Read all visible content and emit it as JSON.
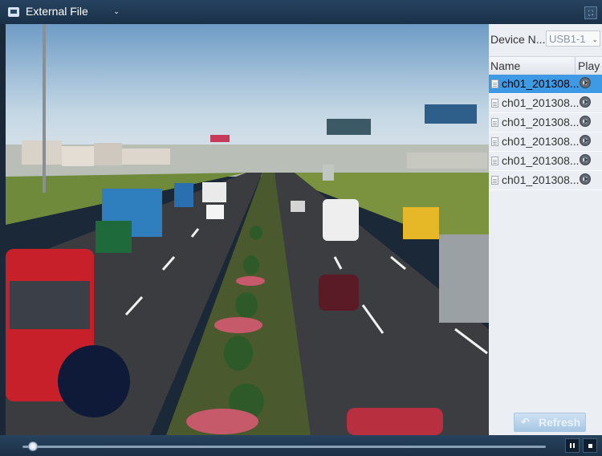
{
  "topbar": {
    "title": "External File",
    "title_chevron": "⌄",
    "fullscreen_icon": "⛶"
  },
  "panel": {
    "device_label": "Device N...",
    "device_value": "USB1-1",
    "device_chevron": "⌄",
    "columns": {
      "name": "Name",
      "play": "Play"
    },
    "files": [
      {
        "name": "ch01_201308...",
        "selected": true
      },
      {
        "name": "ch01_201308...",
        "selected": false
      },
      {
        "name": "ch01_201308...",
        "selected": false
      },
      {
        "name": "ch01_201308...",
        "selected": false
      },
      {
        "name": "ch01_201308...",
        "selected": false
      },
      {
        "name": "ch01_201308...",
        "selected": false
      }
    ],
    "refresh_label": "Refresh",
    "refresh_icon": "↶"
  },
  "colors": {
    "titlebar": "#1f3850",
    "selection": "#3f9ae6",
    "panel_bg": "#ebeef2"
  },
  "playback": {
    "progress": 0.02
  }
}
